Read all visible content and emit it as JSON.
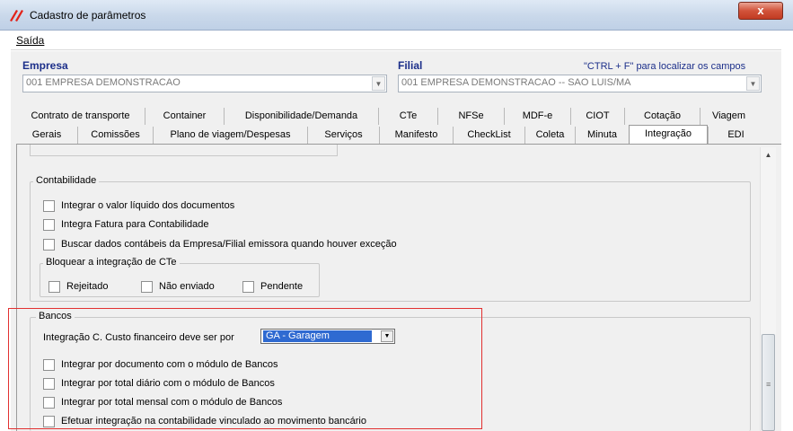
{
  "window": {
    "title": "Cadastro de parâmetros",
    "close_label": "x"
  },
  "menu": {
    "saida": "Saída"
  },
  "header": {
    "empresa_label": "Empresa",
    "empresa_value": "001 EMPRESA DEMONSTRACAO",
    "filial_label": "Filial",
    "filial_value": "001 EMPRESA DEMONSTRACAO -- SAO LUIS/MA",
    "hint": "\"CTRL + F\" para localizar os campos"
  },
  "tabs_row1": [
    "Contrato de transporte",
    "Container",
    "Disponibilidade/Demanda",
    "CTe",
    "NFSe",
    "MDF-e",
    "CIOT",
    "Cotação",
    "Viagem"
  ],
  "tabs_row2": [
    "Gerais",
    "Comissões",
    "Plano de viagem/Despesas",
    "Serviços",
    "Manifesto",
    "CheckList",
    "Coleta",
    "Minuta",
    "Integração",
    "EDI"
  ],
  "active_tab": "Integração",
  "contabilidade": {
    "title": "Contabilidade",
    "options": [
      "Integrar o valor líquido dos documentos",
      "Integra Fatura para Contabilidade",
      "Buscar dados contábeis da Empresa/Filial emissora quando houver exceção"
    ],
    "bloquear": {
      "title": "Bloquear a integração de CTe",
      "options": [
        "Rejeitado",
        "Não enviado",
        "Pendente"
      ]
    }
  },
  "bancos": {
    "title": "Bancos",
    "custo_label": "Integração C. Custo financeiro deve ser por",
    "custo_value": "GA - Garagem",
    "options": [
      "Integrar por documento com o módulo de Bancos",
      "Integrar por total diário com o módulo de Bancos",
      "Integrar por total mensal com o módulo de Bancos",
      "Efetuar integração na contabilidade vinculado ao movimento bancário"
    ]
  },
  "colors": {
    "accent_label": "#1c2f8a",
    "highlight_box": "#e23030",
    "selection": "#2f6ad1"
  }
}
